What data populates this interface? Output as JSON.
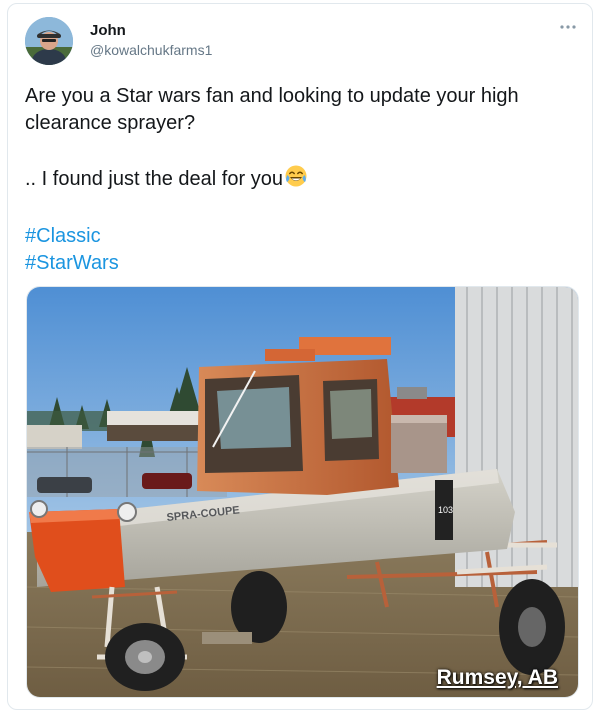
{
  "tweet": {
    "display_name": "John",
    "handle": "@kowalchukfarms1",
    "more_glyph": "···",
    "lines": [
      "Are you a Star wars fan and looking to update your high clearance sprayer?",
      ".. I found just the deal for you"
    ],
    "emoji": "face-with-tears-of-joy",
    "hashtags": [
      "#Classic",
      "#StarWars"
    ]
  },
  "photo": {
    "location_label": "Rumsey, AB",
    "vehicle_brand_text": "SPRA-COUPE",
    "unit_number": "103"
  },
  "colors": {
    "hashtag": "#1b95e0",
    "text": "#14171a",
    "secondary_text": "#657786",
    "border": "#e1e8ed",
    "sky": "#5f9ad6",
    "sprayer_body": "#b9b7ae",
    "sprayer_orange": "#e04e1c",
    "cab_rust": "#c26a3c"
  }
}
